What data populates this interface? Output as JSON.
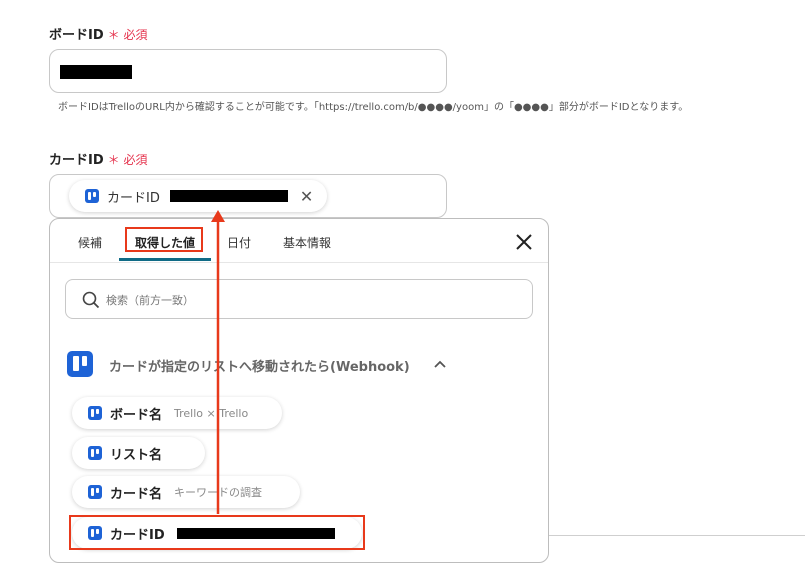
{
  "board_field": {
    "label": "ボードID",
    "required_mark": "＊",
    "required_text": "必須",
    "hint": "ボードIDはTrelloのURL内から確認することが可能です。「https://trello.com/b/●●●●/yoom」の「●●●●」部分がボードIDとなります。"
  },
  "card_field": {
    "label": "カードID",
    "required_mark": "＊",
    "required_text": "必須",
    "token_label": "カードID"
  },
  "tabs": [
    "候補",
    "取得した値",
    "日付",
    "基本情報"
  ],
  "search": {
    "placeholder": "検索（前方一致）"
  },
  "section": {
    "title": "カードが指定のリストへ移動されたら(Webhook)"
  },
  "items": [
    {
      "name": "ボード名",
      "sub": "Trello × Trello"
    },
    {
      "name": "リスト名",
      "sub": ""
    },
    {
      "name": "カード名",
      "sub": "キーワードの調査"
    },
    {
      "name": "カードID",
      "sub": ""
    }
  ],
  "colors": {
    "accent": "#1e63d6",
    "required": "#e5334d",
    "highlight": "#e8391b",
    "tab_underline": "#0f6b86"
  }
}
